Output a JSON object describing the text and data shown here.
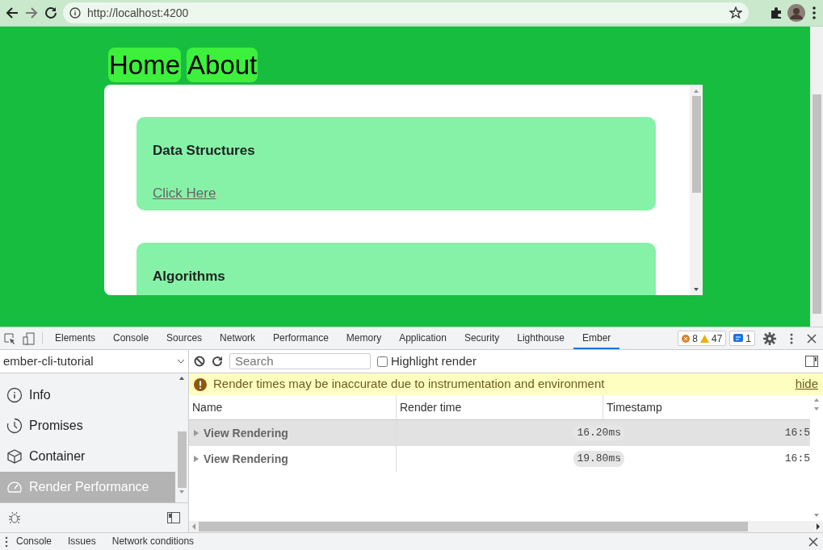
{
  "browser": {
    "url": "http://localhost:4200"
  },
  "page": {
    "nav": [
      {
        "label": "Home"
      },
      {
        "label": "About"
      }
    ],
    "cards": [
      {
        "title": "Data Structures",
        "link": "Click Here"
      },
      {
        "title": "Algorithms"
      }
    ]
  },
  "devtools": {
    "tabs": [
      {
        "label": "Elements",
        "selected": false
      },
      {
        "label": "Console",
        "selected": false
      },
      {
        "label": "Sources",
        "selected": false
      },
      {
        "label": "Network",
        "selected": false
      },
      {
        "label": "Performance",
        "selected": false
      },
      {
        "label": "Memory",
        "selected": false
      },
      {
        "label": "Application",
        "selected": false
      },
      {
        "label": "Security",
        "selected": false
      },
      {
        "label": "Lighthouse",
        "selected": false
      },
      {
        "label": "Ember",
        "selected": true
      }
    ],
    "counts": {
      "errors": "8",
      "warnings": "47",
      "messages": "1"
    },
    "sidebar": {
      "app": "ember-cli-tutorial",
      "items": [
        {
          "label": "Info",
          "selected": false
        },
        {
          "label": "Promises",
          "selected": false
        },
        {
          "label": "Container",
          "selected": false
        },
        {
          "label": "Render Performance",
          "selected": true
        }
      ]
    },
    "toolbar": {
      "search": {
        "placeholder": "Search"
      },
      "highlight": {
        "label": "Highlight render",
        "checked": false
      }
    },
    "warning": {
      "text": "Render times may be inaccurate due to instrumentation and environment",
      "action": "hide"
    },
    "table": {
      "columns": [
        "Name",
        "Render time",
        "Timestamp"
      ],
      "rows": [
        {
          "name": "View Rendering",
          "render_time": "16.20ms",
          "timestamp": "16:5",
          "selected": true
        },
        {
          "name": "View Rendering",
          "render_time": "19.80ms",
          "timestamp": "16:5",
          "selected": false
        }
      ]
    },
    "drawer": {
      "tabs": [
        {
          "label": "Console"
        },
        {
          "label": "Issues"
        },
        {
          "label": "Network conditions"
        }
      ]
    }
  }
}
